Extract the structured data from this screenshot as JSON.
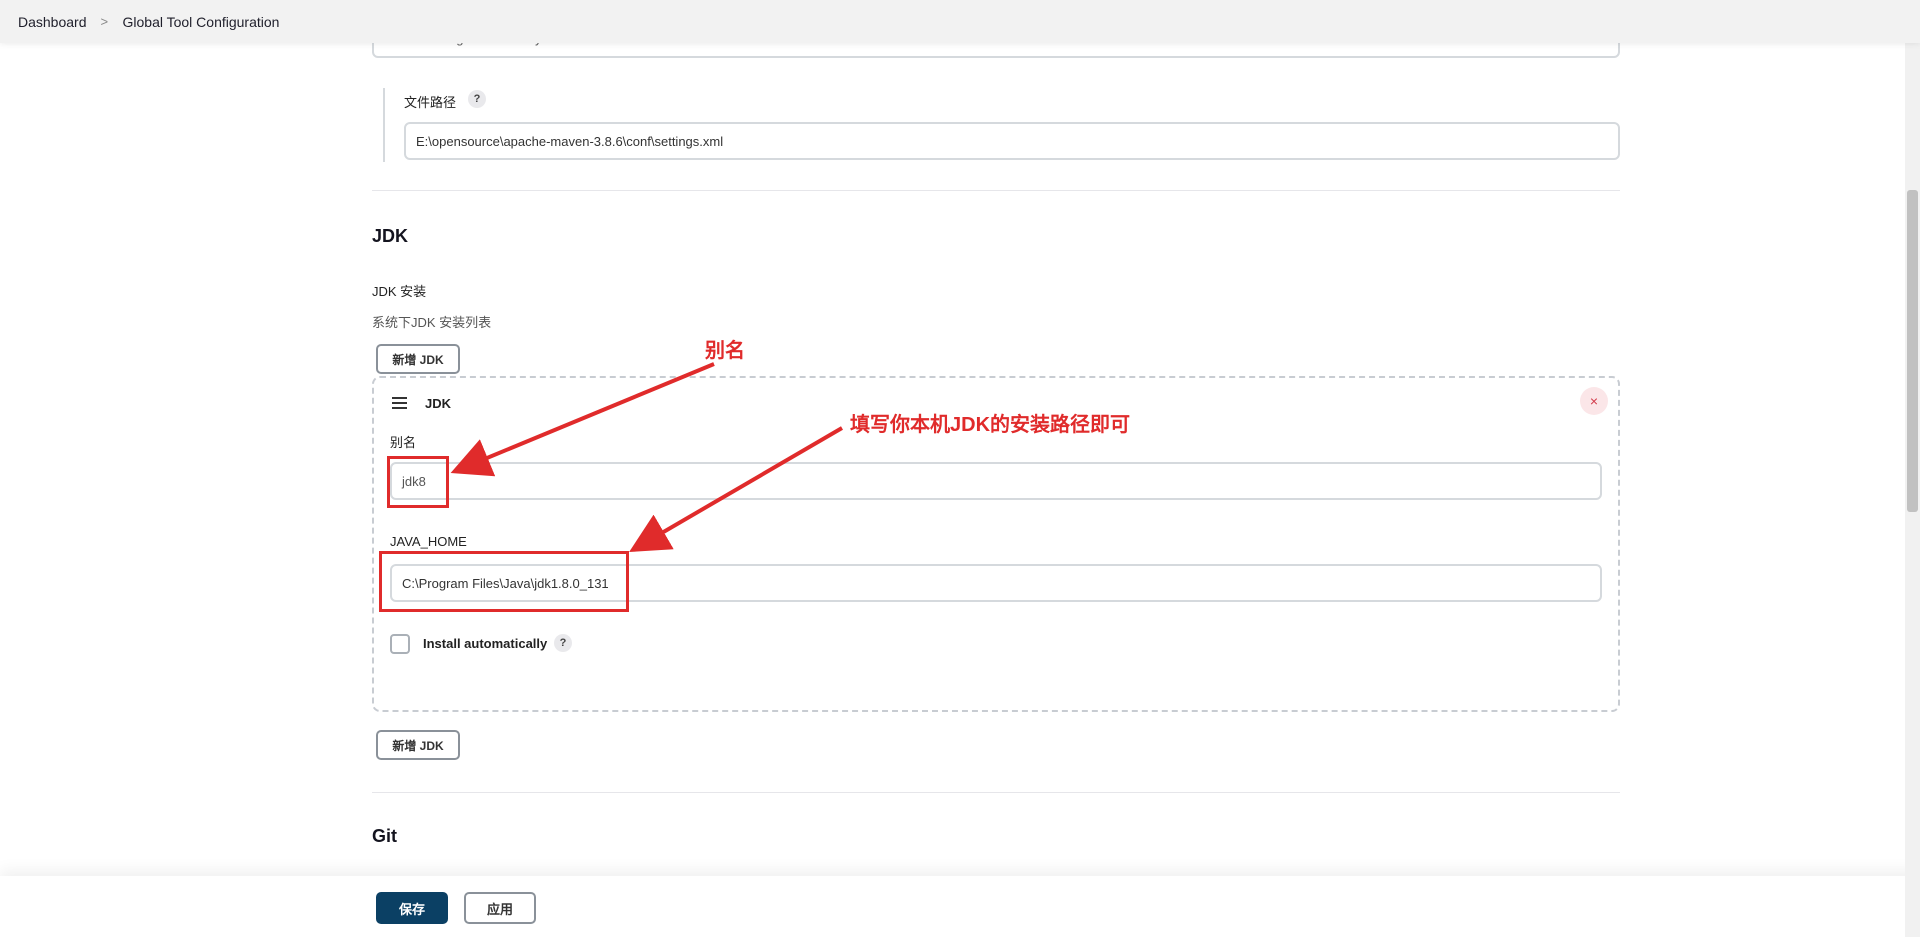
{
  "breadcrumb": {
    "items": [
      "Dashboard",
      "Global Tool Configuration"
    ],
    "separator": ">"
  },
  "maven_settings": {
    "provider_value": "Global settings file on filesystem",
    "file_path_label": "文件路径",
    "file_path_value": "E:\\opensource\\apache-maven-3.8.6\\conf\\settings.xml",
    "help_glyph": "?"
  },
  "jdk_section": {
    "title": "JDK",
    "installations_label": "JDK 安装",
    "installations_desc": "系统下JDK 安装列表",
    "add_button_top": "新增 JDK",
    "add_button_bottom": "新增 JDK",
    "entry": {
      "header": "JDK",
      "close_glyph": "×",
      "alias_label": "别名",
      "alias_value": "jdk8",
      "java_home_label": "JAVA_HOME",
      "java_home_value": "C:\\Program Files\\Java\\jdk1.8.0_131",
      "install_auto_label": "Install automatically",
      "install_auto_checked": false,
      "help_glyph": "?"
    }
  },
  "git_section": {
    "title": "Git"
  },
  "annotations": {
    "alias_note": "别名",
    "path_note": "填写你本机JDK的安装路径即可",
    "color": "#e02b2b"
  },
  "footer": {
    "save_label": "保存",
    "apply_label": "应用"
  },
  "colors": {
    "primary": "#0b4064",
    "danger": "#d23a4a"
  }
}
